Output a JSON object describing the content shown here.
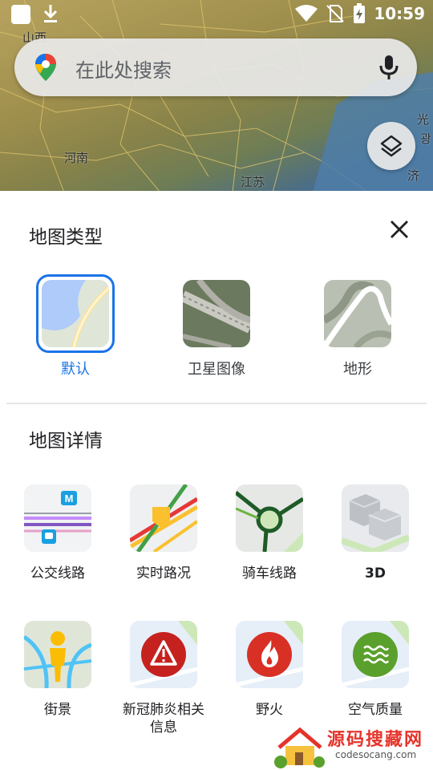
{
  "status_bar": {
    "time": "10:59"
  },
  "map": {
    "labels": [
      "山西",
      "河南",
      "江苏",
      "光",
      "광",
      "济"
    ]
  },
  "search": {
    "placeholder": "在此处搜索"
  },
  "map_type": {
    "title": "地图类型",
    "options": [
      {
        "label": "默认",
        "selected": true
      },
      {
        "label": "卫星图像",
        "selected": false
      },
      {
        "label": "地形",
        "selected": false
      }
    ]
  },
  "map_details": {
    "title": "地图详情",
    "items": [
      {
        "label": "公交线路"
      },
      {
        "label": "实时路况"
      },
      {
        "label": "骑车线路"
      },
      {
        "label": "3D"
      },
      {
        "label": "街景"
      },
      {
        "label": "新冠肺炎相关信息"
      },
      {
        "label": "野火"
      },
      {
        "label": "空气质量"
      }
    ]
  },
  "watermark": {
    "title": "源码搜藏网",
    "url": "codesocang.com"
  },
  "colors": {
    "accent": "#1a73e8",
    "wildfire": "#d93025",
    "air": "#5aa02c"
  }
}
